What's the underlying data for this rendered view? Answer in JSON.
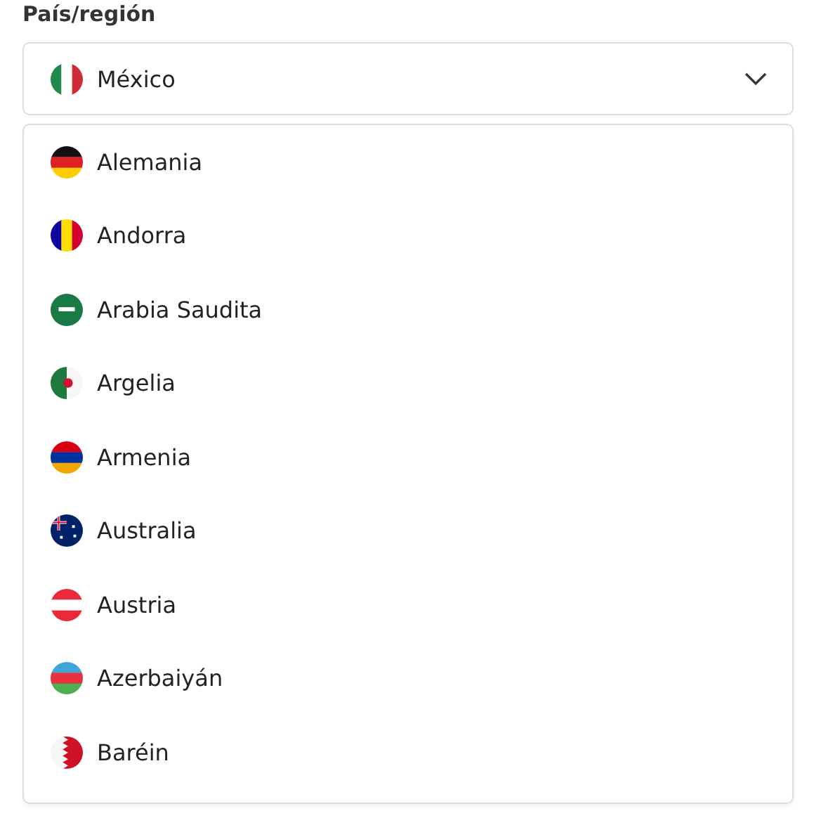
{
  "field": {
    "label": "País/región",
    "value": "México",
    "kind": "mexico"
  },
  "options": [
    {
      "name": "Alemania",
      "kind": "germany"
    },
    {
      "name": "Andorra",
      "kind": "andorra"
    },
    {
      "name": "Arabia Saudita",
      "kind": "saudi"
    },
    {
      "name": "Argelia",
      "kind": "algeria"
    },
    {
      "name": "Armenia",
      "kind": "armenia"
    },
    {
      "name": "Australia",
      "kind": "australia"
    },
    {
      "name": "Austria",
      "kind": "austria"
    },
    {
      "name": "Azerbaiyán",
      "kind": "azerbaijan"
    },
    {
      "name": "Baréin",
      "kind": "bahrain"
    }
  ]
}
